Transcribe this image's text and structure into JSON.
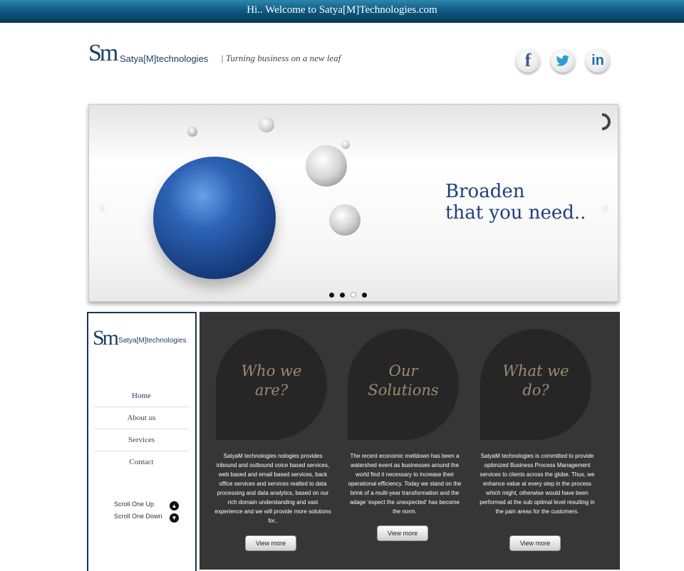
{
  "top_banner": {
    "text": "Hi.. Welcome to Satya[M]Technologies.com"
  },
  "header": {
    "logo_mark": "Sm",
    "logo_text": "Satya[M]technologies",
    "tagline": "| Turning business on a new leaf"
  },
  "social": {
    "facebook": "f",
    "linkedin": "in"
  },
  "slider": {
    "headline_line1": "Broaden",
    "headline_line2": "that you need..",
    "prev_symbol": "‹",
    "next_symbol": "›",
    "slide_count": 4,
    "active_slide": 3
  },
  "sidebar": {
    "logo_mark": "Sm",
    "logo_text": "Satya[M]technologies",
    "nav": [
      "Home",
      "About us",
      "Services",
      "Contact"
    ],
    "scroll_up": "Scroll One Up",
    "scroll_down": "Scroll One Down"
  },
  "features": [
    {
      "title_line1": "Who we",
      "title_line2": "are?",
      "text": "SatyaM technologies nologies provides inbound and outbound voice based services, web based and email based services, back office services and services realted to data processing and data analytics, based on our rich domain understanding and vast experience and we will provide more solutions for..",
      "button": "View more"
    },
    {
      "title_line1": "Our",
      "title_line2": "Solutions",
      "text": "The recent economic meltdown has been a watershed event as businesses around the world find it necessary to increase their operational efficiency. Today we stand on the brink of a multi-year transformation and the adage 'expect the unexpected' has become the norm.",
      "button": "View more"
    },
    {
      "title_line1": "What we",
      "title_line2": "do?",
      "text": "SatyaM technologies is committed to provide optimized Business Process Management services to clients across the globe. Thus, we enhance value at every step in the process which might, otherwise would have been performed at the sub optimal level resulting in the pain areas for the customers.",
      "button": "View more"
    }
  ],
  "colors": {
    "topbar": "#0f5c86",
    "brand_navy": "#1a3557",
    "panel_bg": "#363636",
    "drop_bg": "#262626",
    "drop_title": "#9d8a72",
    "headline": "#1d3f7c"
  }
}
